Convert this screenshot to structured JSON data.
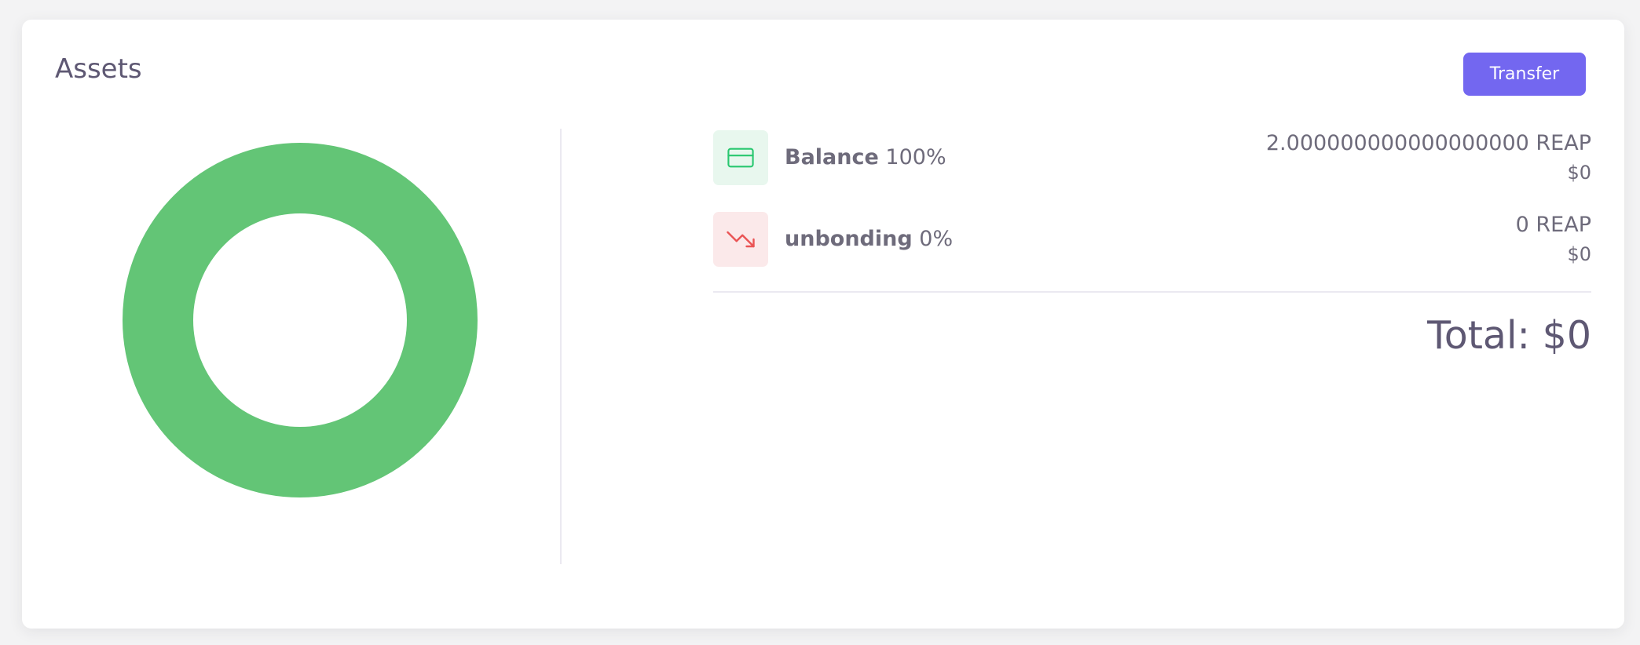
{
  "card": {
    "title": "Assets",
    "transfer_label": "Transfer"
  },
  "assets": [
    {
      "name": "Balance",
      "percent": "100%",
      "amount": "2.000000000000000000 REAP",
      "usd": "$0",
      "icon": "credit-card-icon",
      "icon_color": "#28c76f",
      "icon_bg": "#e8f7ee"
    },
    {
      "name": "unbonding",
      "percent": "0%",
      "amount": "0 REAP",
      "usd": "$0",
      "icon": "trending-down-icon",
      "icon_color": "#ea5455",
      "icon_bg": "#fbe9ea"
    }
  ],
  "total": {
    "text": "Total: $0"
  },
  "chart_data": {
    "type": "pie",
    "style": "donut",
    "categories": [
      "Balance",
      "unbonding"
    ],
    "values": [
      100,
      0
    ],
    "colors": [
      "#63c576",
      "#ea5455"
    ],
    "legend": "none"
  }
}
